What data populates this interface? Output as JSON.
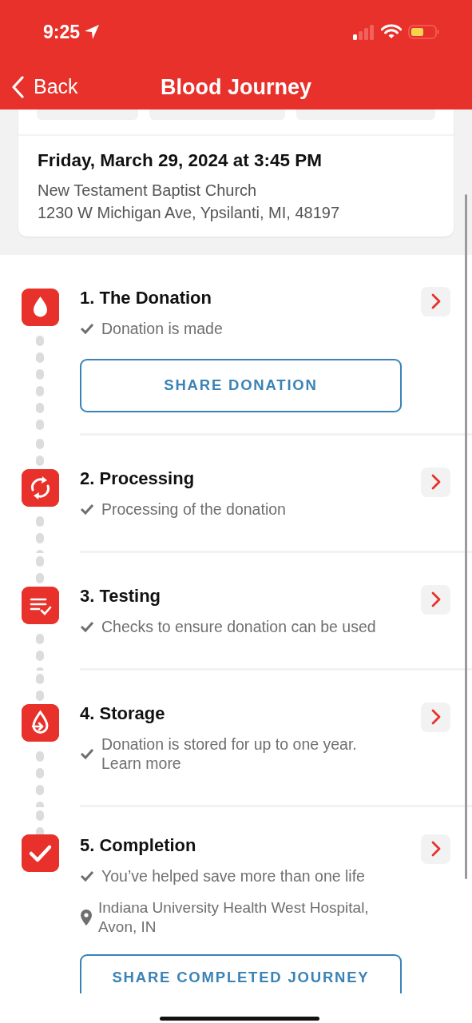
{
  "status_bar": {
    "time": "9:25"
  },
  "nav": {
    "back_label": "Back",
    "title": "Blood Journey"
  },
  "donation_card": {
    "date": "Friday, March 29, 2024 at 3:45 PM",
    "location_name": "New Testament Baptist Church",
    "address": "1230 W Michigan Ave, Ypsilanti, MI, 48197"
  },
  "steps": [
    {
      "kind": "drop",
      "title": "1. The Donation",
      "status": "Donation is made",
      "completed": true,
      "button": "SHARE DONATION"
    },
    {
      "kind": "refresh",
      "title": "2. Processing",
      "status": "Processing of the donation",
      "completed": true
    },
    {
      "kind": "checklist",
      "title": "3. Testing",
      "status": "Checks to ensure donation can be used",
      "completed": true
    },
    {
      "kind": "storage",
      "title": "4. Storage",
      "status": "Donation is stored for up to one year. Learn more",
      "completed": true
    },
    {
      "kind": "check",
      "title": "5. Completion",
      "status": "You’ve helped save more than one life",
      "completed": true,
      "location": "Indiana University Health West Hospital, Avon, IN",
      "button": "SHARE COMPLETED JOURNEY"
    }
  ]
}
